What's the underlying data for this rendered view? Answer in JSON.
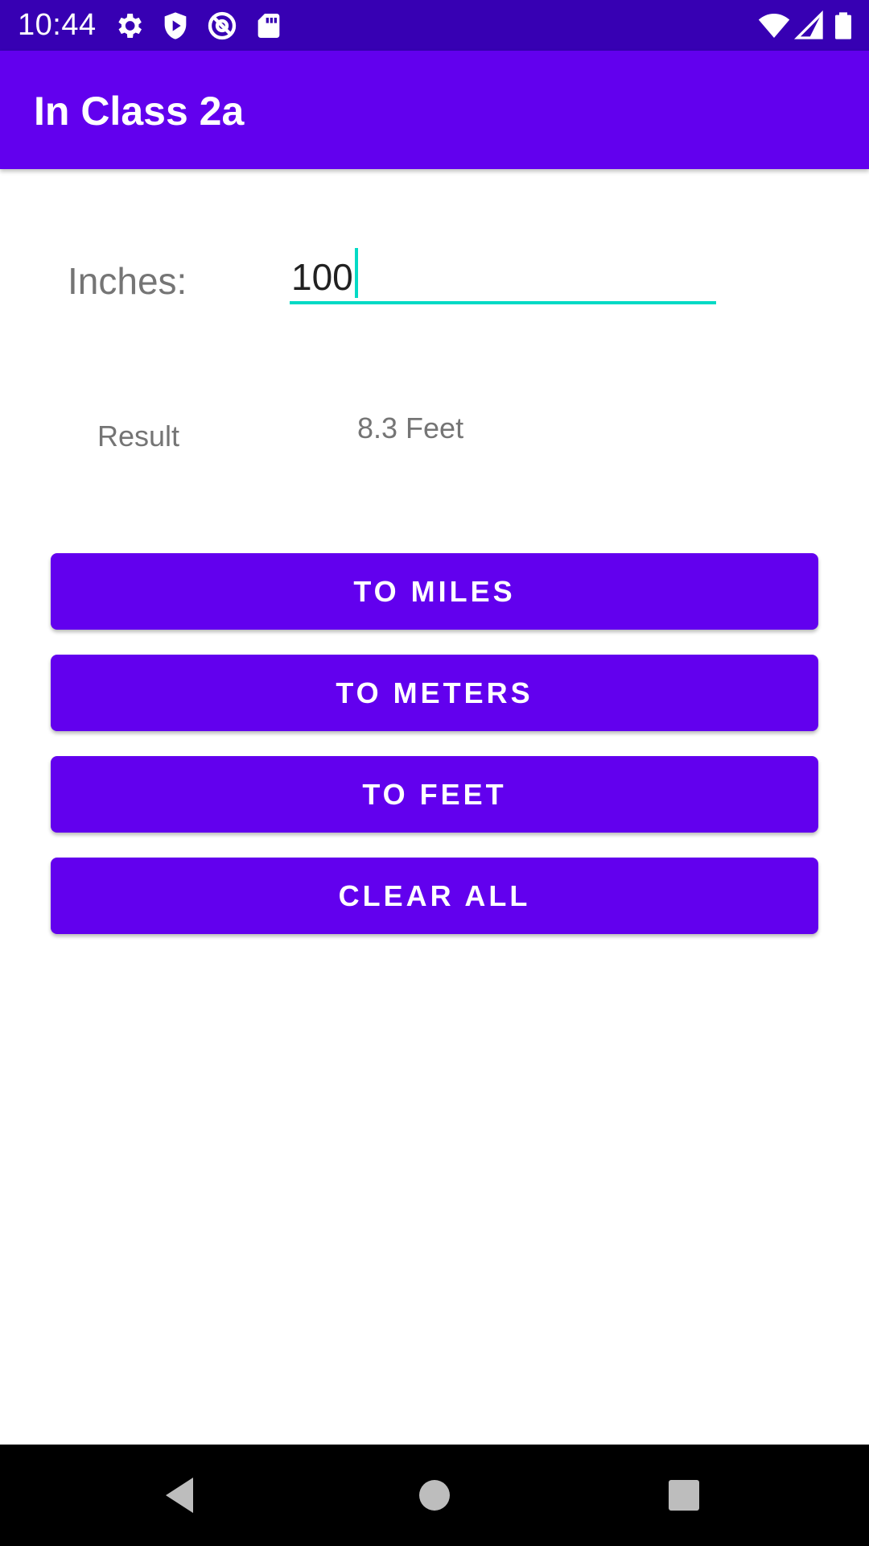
{
  "status_bar": {
    "time": "10:44",
    "left_icons": [
      "gear-icon",
      "shield-play-icon",
      "at-sign-icon",
      "sd-card-icon"
    ],
    "right_icons": [
      "wifi-icon",
      "cell-signal-icon",
      "battery-icon"
    ],
    "background": "#3700b3"
  },
  "app_bar": {
    "title": "In Class 2a",
    "background": "#6200ee"
  },
  "form": {
    "inches_label": "Inches:",
    "inches_value": "100",
    "result_label": "Result",
    "result_value": "8.3 Feet",
    "underline_color": "#03dac5"
  },
  "buttons": {
    "to_miles": "TO MILES",
    "to_meters": "TO METERS",
    "to_feet": "TO FEET",
    "clear_all": "CLEAR ALL",
    "color": "#6200ee"
  },
  "nav_bar": {
    "icons": [
      "back-icon",
      "home-icon",
      "recents-icon"
    ]
  }
}
